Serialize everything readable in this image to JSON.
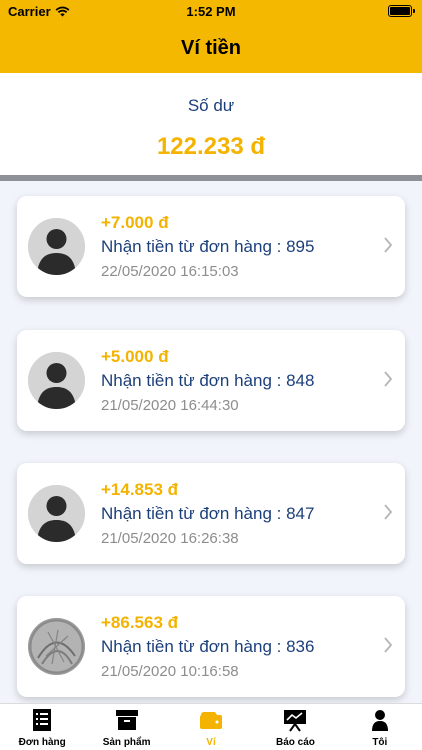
{
  "status_bar": {
    "carrier": "Carrier",
    "time": "1:52 PM"
  },
  "header": {
    "title": "Ví tiền"
  },
  "balance": {
    "label": "Số dư",
    "value": "122.233 đ"
  },
  "transactions": [
    {
      "amount": "+7.000 đ",
      "description": "Nhận tiền từ đơn hàng : 895",
      "datetime": "22/05/2020 16:15:03",
      "avatar": "default-user-avatar"
    },
    {
      "amount": "+5.000 đ",
      "description": "Nhận tiền từ đơn hàng : 848",
      "datetime": "21/05/2020 16:44:30",
      "avatar": "default-user-avatar"
    },
    {
      "amount": "+14.853 đ",
      "description": "Nhận tiền từ đơn hàng : 847",
      "datetime": "21/05/2020 16:26:38",
      "avatar": "default-user-avatar"
    },
    {
      "amount": "+86.563 đ",
      "description": "Nhận tiền từ đơn hàng : 836",
      "datetime": "21/05/2020 10:16:58",
      "avatar": "photo-avatar"
    }
  ],
  "tabbar": {
    "active": "Ví",
    "items": [
      {
        "label": "Đơn hàng",
        "icon": "document-list-icon"
      },
      {
        "label": "Sản phẩm",
        "icon": "box-icon"
      },
      {
        "label": "Ví",
        "icon": "wallet-icon"
      },
      {
        "label": "Báo cáo",
        "icon": "presentation-chart-icon"
      },
      {
        "label": "Tôi",
        "icon": "person-icon"
      }
    ]
  },
  "colors": {
    "accent": "#f5b800",
    "amount": "#f3b300",
    "text_primary": "#1c3f7a",
    "text_secondary": "#8d8d8d"
  }
}
